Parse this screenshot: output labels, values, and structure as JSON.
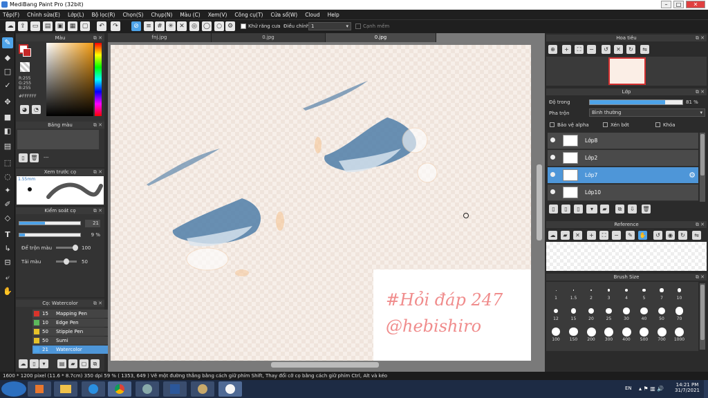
{
  "window": {
    "title": "MediBang Paint Pro (32bit)",
    "minimize": "–",
    "maximize": "□",
    "close": "✕"
  },
  "menu": [
    "Tệp(F)",
    "Chỉnh sửa(E)",
    "Lớp(L)",
    "Bộ lọc(R)",
    "Chọn(S)",
    "Chụp(N)",
    "Màu (C)",
    "Xem(V)",
    "Công cụ(T)",
    "Cửa sổ(W)",
    "Cloud",
    "Help"
  ],
  "toolbar": {
    "antialias_label": "Khử răng cưa",
    "correction_label": "Điều chỉnh",
    "correction_value": "1",
    "soft_edge_label": "Cạnh mềm"
  },
  "color_panel": {
    "title": "Màu",
    "r": "R:255",
    "g": "G:255",
    "b": "B:255",
    "hex": "#FFFFFF"
  },
  "palette_panel": {
    "title": "Bảng màu",
    "value": "---"
  },
  "preview_panel": {
    "title": "Xem trước cọ",
    "size": "1.55mm"
  },
  "brush_control": {
    "title": "Kiểm soát cọ",
    "size_value": "21",
    "opacity_value": "9 %",
    "mix_label": "Để trộn màu",
    "mix_value": "100",
    "reload_label": "Tải màu",
    "reload_value": "50"
  },
  "brush_list": {
    "title": "Cọ: Watercolor",
    "items": [
      {
        "num": "15",
        "name": "Mapping Pen",
        "color": "#d9342b"
      },
      {
        "num": "10",
        "name": "Edge Pen",
        "color": "#5cb85c"
      },
      {
        "num": "50",
        "name": "Stipple Pen",
        "color": "#e6c229"
      },
      {
        "num": "50",
        "name": "Sumi",
        "color": "#e6c229"
      },
      {
        "num": "21",
        "name": "Watercolor",
        "color": "#4ea3e8"
      }
    ]
  },
  "tabs": [
    "fnj.jpg",
    "0.jpg",
    "0.jpg"
  ],
  "canvas": {
    "watermark1": "#Hỏi đáp 247",
    "watermark2": "@hebishiro"
  },
  "navigator": {
    "title": "Hoa tiêu"
  },
  "layer_panel": {
    "title": "Lớp",
    "opacity_label": "Độ trong",
    "opacity_value": "81 %",
    "opacity_fraction": 0.81,
    "blend_label": "Pha trộn",
    "blend_value": "Bình thường",
    "protect_alpha": "Bảo vệ alpha",
    "clipping": "Xén bớt",
    "lock": "Khóa",
    "layers": [
      {
        "name": "Lớp8"
      },
      {
        "name": "Lớp2"
      },
      {
        "name": "Lớp7"
      },
      {
        "name": "Lớp10"
      }
    ]
  },
  "reference": {
    "title": "Reference"
  },
  "brush_size": {
    "title": "Brush Size",
    "sizes": [
      "1",
      "1.5",
      "2",
      "3",
      "4",
      "5",
      "7",
      "10",
      "12",
      "15",
      "20",
      "25",
      "30",
      "40",
      "50",
      "70",
      "100",
      "150",
      "200",
      "300",
      "400",
      "500",
      "700",
      "1000"
    ]
  },
  "status": {
    "text": "1600 * 1200 pixel   (11.6 * 8.7cm)   350 dpi   59 %   ( 1353, 649 )   Vẽ một đường thẳng bằng cách giữ phím Shift, Thay đổi cỡ cọ bằng cách giữ phím Ctrl, Alt và kéo"
  },
  "taskbar": {
    "lang": "EN",
    "time": "14:21 PM",
    "date": "31/7/2021"
  }
}
